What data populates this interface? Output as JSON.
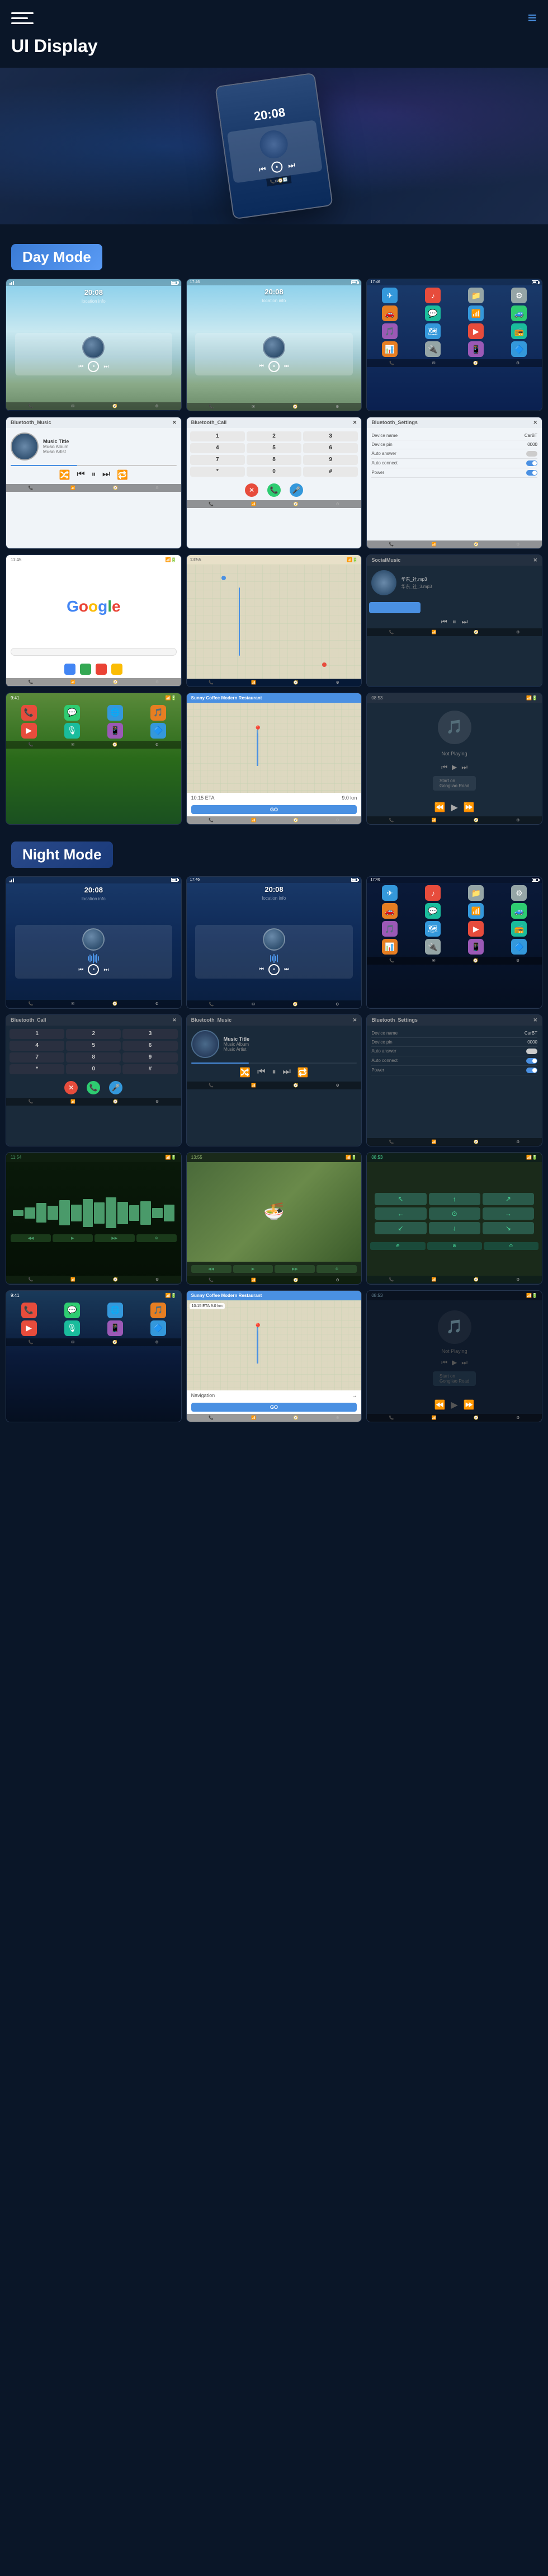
{
  "header": {
    "title": "UI Display",
    "menu_label": "Menu",
    "nav_label": "Navigation"
  },
  "day_mode": {
    "label": "Day Mode"
  },
  "night_mode": {
    "label": "Night Mode"
  },
  "screens": {
    "time": "20:08",
    "music_title": "Music Title",
    "music_album": "Music Album",
    "music_artist": "Music Artist",
    "bluetooth_music": "Bluetooth_Music",
    "bluetooth_call": "Bluetooth_Call",
    "bluetooth_settings": "Bluetooth_Settings",
    "device_name": "CarBT",
    "device_pin": "0000",
    "auto_answer": "Auto answer",
    "auto_connect": "Auto connect",
    "power": "Power",
    "restaurant": "Sunny Coffee Modern Restaurant",
    "restaurant_desc": "Sunny Coffee Modern Restaurant",
    "eta_label": "10:15 ETA",
    "distance": "9.0 km",
    "go": "GO",
    "social_music": "SocialMusic",
    "not_playing": "Not Playing",
    "start_on": "Start on",
    "gongliao": "Gongliao Road",
    "music_file1": "华东_社.mp3",
    "music_file2": "华东_社_3.mp3"
  },
  "day_screens": [
    {
      "id": "day-home-1",
      "type": "home",
      "variant": "day"
    },
    {
      "id": "day-home-2",
      "type": "home",
      "variant": "day"
    },
    {
      "id": "day-app-grid",
      "type": "appgrid",
      "variant": "day"
    },
    {
      "id": "day-bt-music",
      "type": "btmusic",
      "variant": "day"
    },
    {
      "id": "day-bt-call",
      "type": "btcall",
      "variant": "day"
    },
    {
      "id": "day-bt-settings",
      "type": "btsettings",
      "variant": "day"
    },
    {
      "id": "day-google",
      "type": "google",
      "variant": "day"
    },
    {
      "id": "day-map",
      "type": "map",
      "variant": "day"
    },
    {
      "id": "day-social",
      "type": "social",
      "variant": "day"
    },
    {
      "id": "day-ios-home",
      "type": "ioshome",
      "variant": "day"
    },
    {
      "id": "day-restaurant",
      "type": "restaurant",
      "variant": "day"
    },
    {
      "id": "day-notplaying",
      "type": "notplaying",
      "variant": "day"
    }
  ],
  "night_screens": [
    {
      "id": "night-home-1",
      "type": "home",
      "variant": "night"
    },
    {
      "id": "night-home-2",
      "type": "home",
      "variant": "night"
    },
    {
      "id": "night-app-grid",
      "type": "appgrid",
      "variant": "night"
    },
    {
      "id": "night-bt-call",
      "type": "btcall",
      "variant": "night"
    },
    {
      "id": "night-bt-music",
      "type": "btmusic",
      "variant": "night"
    },
    {
      "id": "night-bt-settings",
      "type": "btsettings",
      "variant": "night"
    },
    {
      "id": "night-wave",
      "type": "wave",
      "variant": "night"
    },
    {
      "id": "night-food",
      "type": "food",
      "variant": "night"
    },
    {
      "id": "night-turn",
      "type": "turn",
      "variant": "night"
    },
    {
      "id": "night-ios-home",
      "type": "ioshome",
      "variant": "night"
    },
    {
      "id": "night-restaurant",
      "type": "restaurant",
      "variant": "night"
    },
    {
      "id": "night-notplaying",
      "type": "notplaying",
      "variant": "night"
    }
  ]
}
